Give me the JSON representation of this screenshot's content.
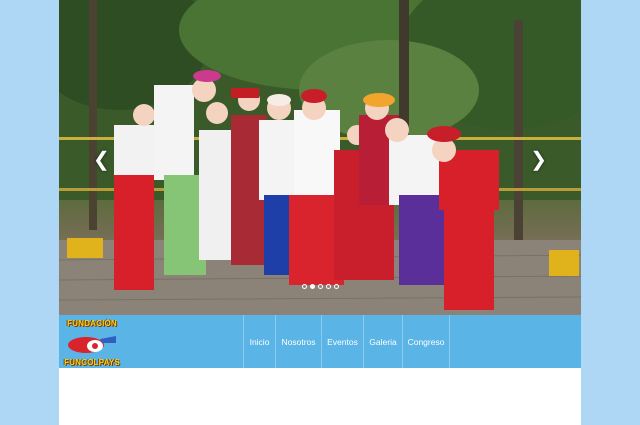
{
  "slider": {
    "image_alt": "Grupo de payasos",
    "prev_icon": "chevron-left-icon",
    "next_icon": "chevron-right-icon",
    "prev_glyph": "❮",
    "next_glyph": "❯",
    "slide_count": 5,
    "active_slide": 2
  },
  "logo": {
    "top_text": "FUNDACIÓN",
    "bottom_text": "FUNCOLPAYS"
  },
  "nav": {
    "items": [
      {
        "label": "Inicio"
      },
      {
        "label": "Nosotros"
      },
      {
        "label": "Eventos"
      },
      {
        "label": "Galeria"
      },
      {
        "label": "Congreso"
      }
    ]
  },
  "colors": {
    "page_background": "#aed6f5",
    "navbar": "#5ab4e6",
    "logo_text": "#f7d21c"
  }
}
